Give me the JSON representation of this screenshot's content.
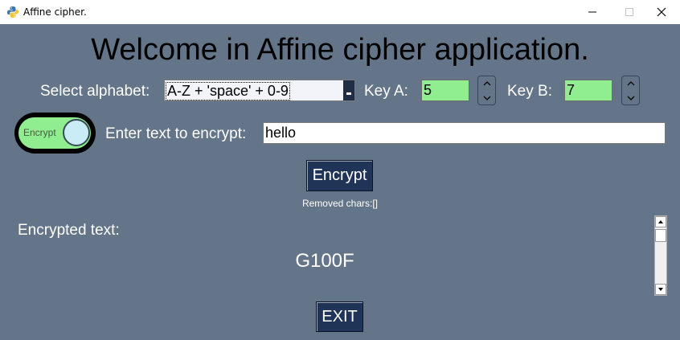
{
  "window": {
    "title": "Affine cipher.",
    "icon": "python-icon",
    "minimize_icon": "minimize-icon",
    "maximize_icon": "maximize-icon",
    "close_icon": "close-icon"
  },
  "heading": "Welcome in Affine cipher application.",
  "alphabet": {
    "label": "Select alphabet:",
    "selected": "A-Z + 'space' + 0-9"
  },
  "key_a": {
    "label": "Key A:",
    "value": "5"
  },
  "key_b": {
    "label": "Key B:",
    "value": "7"
  },
  "mode_toggle": {
    "label": "Encrypt",
    "state": "on"
  },
  "input": {
    "label": "Enter text to encrypt:",
    "value": "hello"
  },
  "encrypt_button": "Encrypt",
  "removed_chars": "Removed chars:[]",
  "output": {
    "label": "Encrypted text:",
    "value": "G100F"
  },
  "exit_button": "EXIT",
  "colors": {
    "background": "#647589",
    "key_field": "#90ee90",
    "button": "#1f3457"
  }
}
